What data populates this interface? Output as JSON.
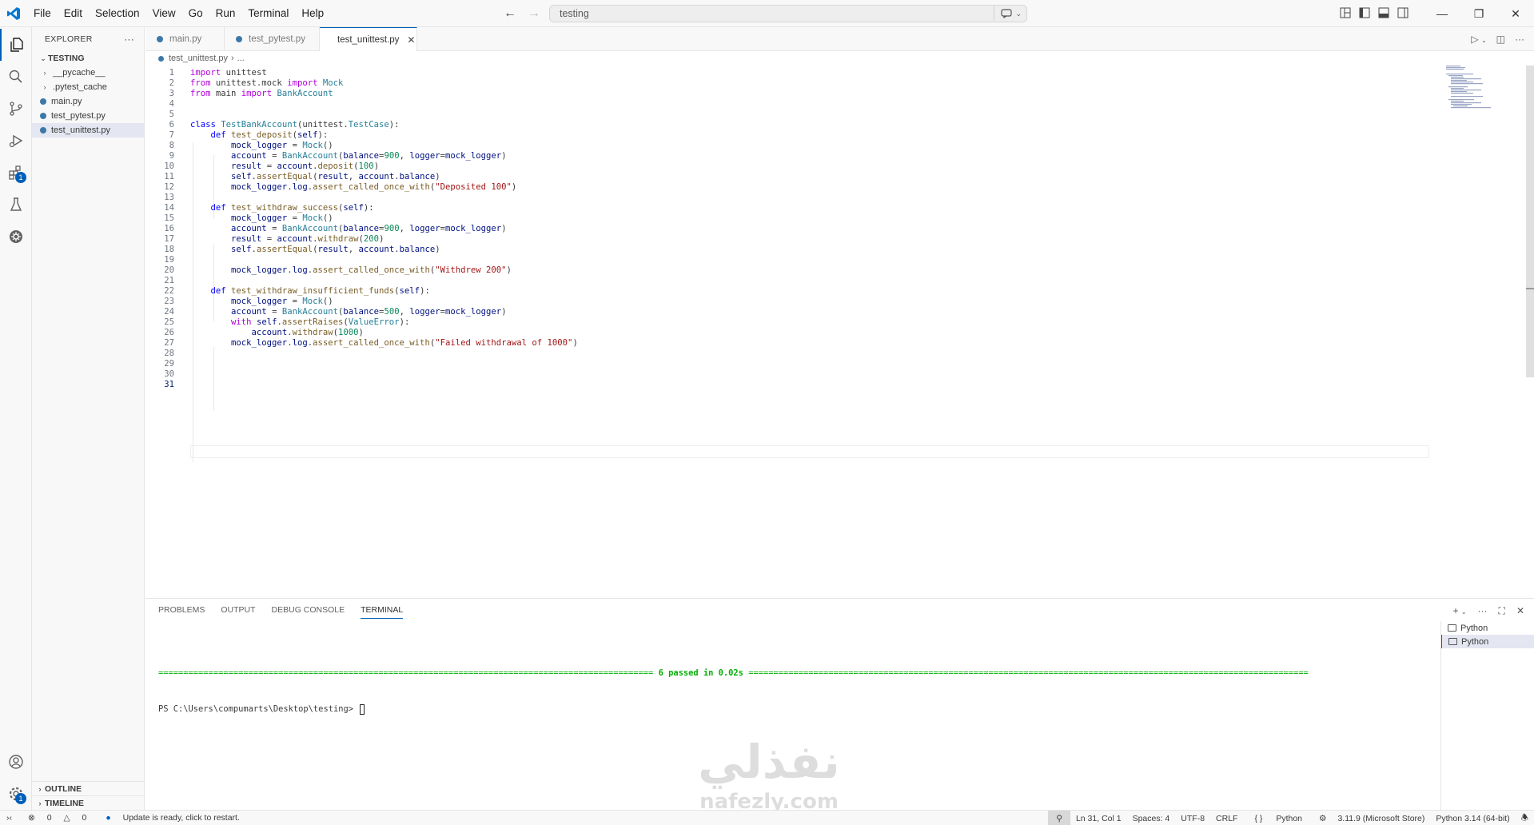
{
  "menu": [
    "File",
    "Edit",
    "Selection",
    "View",
    "Go",
    "Run",
    "Terminal",
    "Help"
  ],
  "command_center": {
    "text": "testing"
  },
  "explorer": {
    "title": "EXPLORER",
    "folder": "TESTING",
    "items": [
      {
        "label": "__pycache__",
        "type": "folder"
      },
      {
        "label": ".pytest_cache",
        "type": "folder"
      },
      {
        "label": "main.py",
        "type": "file"
      },
      {
        "label": "test_pytest.py",
        "type": "file"
      },
      {
        "label": "test_unittest.py",
        "type": "file",
        "selected": true
      }
    ],
    "outline": "OUTLINE",
    "timeline": "TIMELINE"
  },
  "tabs": [
    {
      "label": "main.py"
    },
    {
      "label": "test_pytest.py"
    },
    {
      "label": "test_unittest.py",
      "active": true
    }
  ],
  "breadcrumb": {
    "file": "test_unittest.py",
    "rest": "..."
  },
  "editor": {
    "cursor_line": 31,
    "line_numbers": [
      "1",
      "2",
      "3",
      "4",
      "5",
      "6",
      "7",
      "8",
      "9",
      "10",
      "11",
      "12",
      "13",
      "14",
      "15",
      "16",
      "17",
      "18",
      "19",
      "20",
      "21",
      "22",
      "23",
      "24",
      "25",
      "26",
      "27",
      "28",
      "29",
      "30",
      "31"
    ]
  },
  "panel": {
    "tabs": [
      "PROBLEMS",
      "OUTPUT",
      "DEBUG CONSOLE",
      "TERMINAL"
    ],
    "active_tab": "TERMINAL",
    "terminal_lines": {
      "summary_left": "===================================================================================================",
      "summary_text": " 6 passed in 0.02s ",
      "summary_right": "================================================================================================================",
      "prompt": "PS C:\\Users\\compumarts\\Desktop\\testing> "
    },
    "terminals": [
      "Python",
      "Python"
    ]
  },
  "statusbar": {
    "errors": "0",
    "warnings": "0",
    "update": "Update is ready, click to restart.",
    "position": "Ln 31, Col 1",
    "spaces": "Spaces: 4",
    "encoding": "UTF-8",
    "eol": "CRLF",
    "language": "Python",
    "interpreter": "3.11.9 (Microsoft Store)",
    "python_version": "Python 3.14 (64-bit)"
  },
  "badges": {
    "extensions": "1",
    "manage": "1"
  },
  "watermark": {
    "arabic": "نفذلي",
    "latin": "nafezly.com"
  },
  "colors": {
    "accent": "#005fb8",
    "keyword": "#0000ff",
    "control": "#af00db",
    "class": "#267f99",
    "function": "#795e26",
    "string": "#a31515",
    "number": "#098658",
    "variable": "#001080"
  }
}
